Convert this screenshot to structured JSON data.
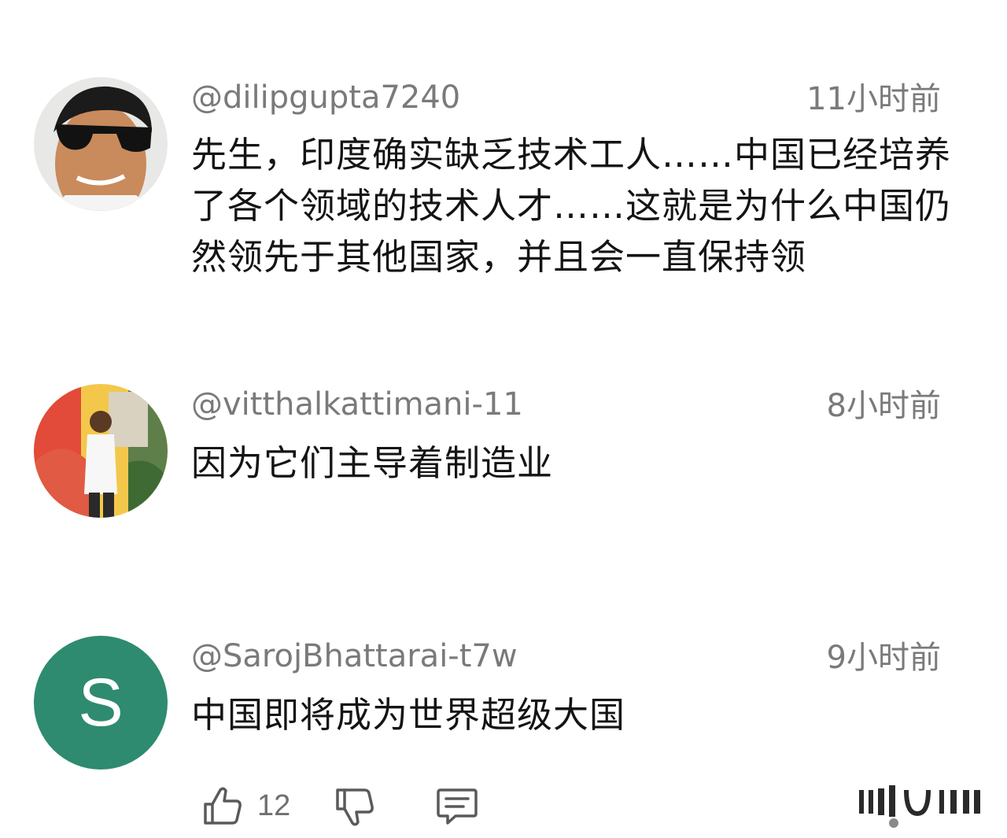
{
  "comments": [
    {
      "handle": "@dilipgupta7240",
      "time": "11小时前",
      "text": "先生，印度确实缺乏技术工人……中国已经培养了各个领域的技术人才……这就是为什么中国仍然领先于其他国家，并且会一直保持领"
    },
    {
      "handle": "@vitthalkattimani-11",
      "time": "8小时前",
      "text": "因为它们主导着制造业"
    },
    {
      "handle": "@SarojBhattarai-t7w",
      "time": "9小时前",
      "text": "中国即将成为世界超级大国",
      "avatar_letter": "S",
      "avatar_color": "#2e8b6f"
    }
  ],
  "actions": {
    "like_count": "12",
    "icons": [
      "thumbs-up-icon",
      "thumbs-down-icon",
      "reply-icon"
    ]
  }
}
